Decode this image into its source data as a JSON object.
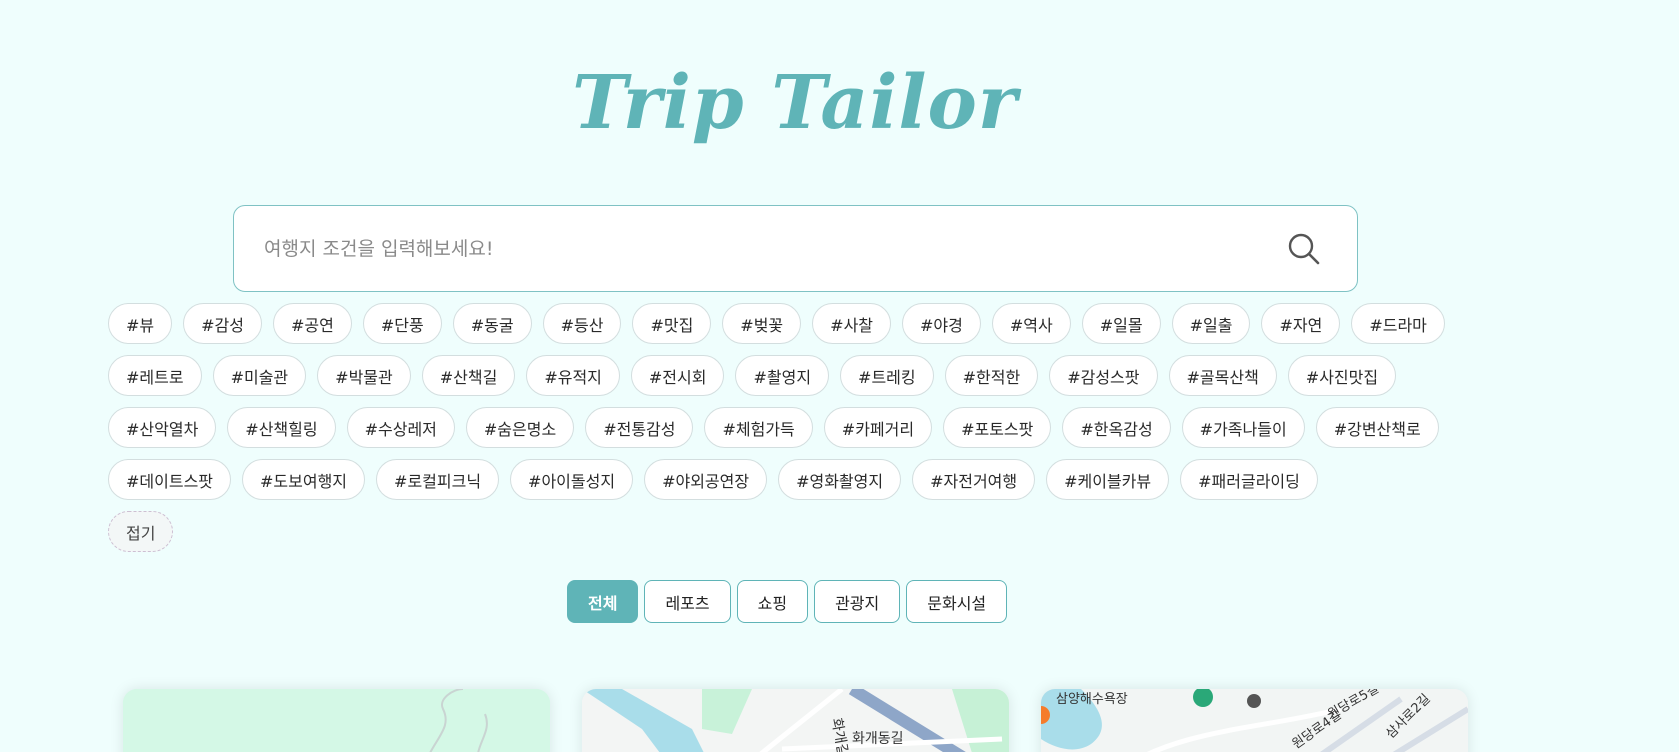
{
  "app": {
    "logo": "Trip Tailor"
  },
  "search": {
    "placeholder": "여행지 조건을 입력해보세요!",
    "value": ""
  },
  "tags": {
    "rows": [
      [
        "#뷰",
        "#감성",
        "#공연",
        "#단풍",
        "#동굴",
        "#등산",
        "#맛집",
        "#벚꽃",
        "#사찰",
        "#야경",
        "#역사",
        "#일몰",
        "#일출",
        "#자연",
        "#드라마"
      ],
      [
        "#레트로",
        "#미술관",
        "#박물관",
        "#산책길",
        "#유적지",
        "#전시회",
        "#촬영지",
        "#트레킹",
        "#한적한",
        "#감성스팟",
        "#골목산책",
        "#사진맛집"
      ],
      [
        "#산악열차",
        "#산책힐링",
        "#수상레저",
        "#숨은명소",
        "#전통감성",
        "#체험가득",
        "#카페거리",
        "#포토스팟",
        "#한옥감성",
        "#가족나들이",
        "#강변산책로"
      ],
      [
        "#데이트스팟",
        "#도보여행지",
        "#로컬피크닉",
        "#아이돌성지",
        "#야외공연장",
        "#영화촬영지",
        "#자전거여행",
        "#케이블카뷰",
        "#패러글라이딩"
      ]
    ],
    "fold_label": "접기"
  },
  "filters": {
    "items": [
      {
        "label": "전체",
        "active": true
      },
      {
        "label": "레포츠",
        "active": false
      },
      {
        "label": "쇼핑",
        "active": false
      },
      {
        "label": "관광지",
        "active": false
      },
      {
        "label": "문화시설",
        "active": false
      }
    ]
  },
  "cards": {
    "map2": {
      "labels": [
        "화개길",
        "화개동길"
      ]
    },
    "map3": {
      "labels": [
        "삼양해수욕장",
        "원당로5길",
        "원당로4길",
        "삼사로2길"
      ]
    }
  },
  "colors": {
    "accent": "#5fb4b7",
    "background": "#effefd"
  }
}
